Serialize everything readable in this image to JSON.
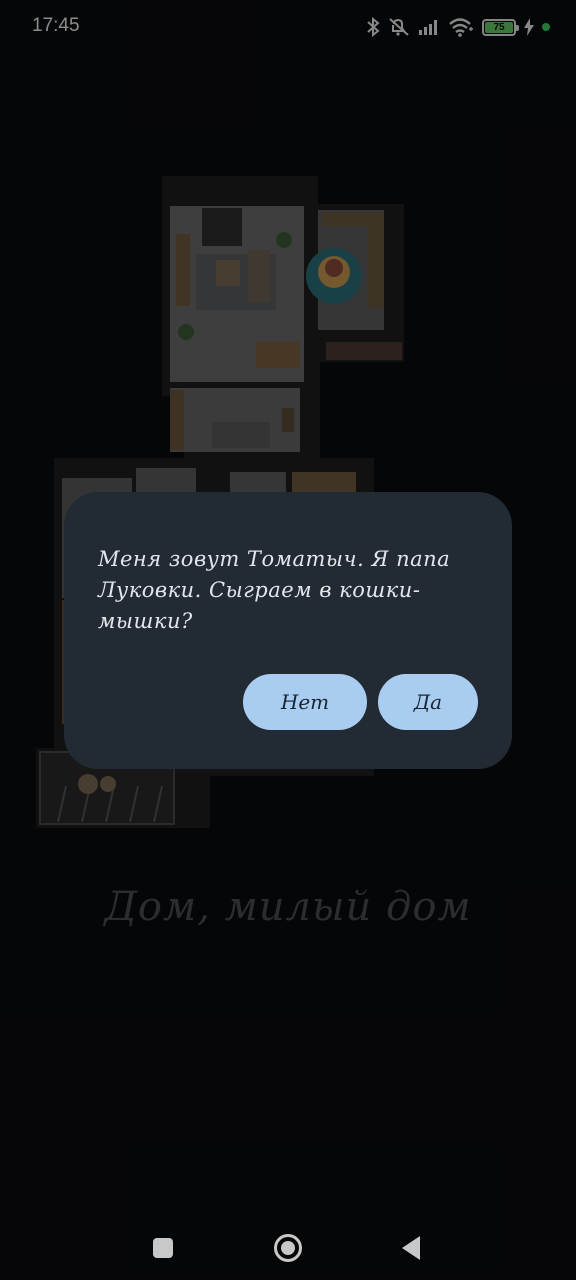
{
  "status_bar": {
    "time": "17:45",
    "battery_level": "75",
    "icons": [
      "bluetooth-icon",
      "mute-icon",
      "signal-icon",
      "wifi-icon",
      "battery-icon",
      "charging-icon",
      "dot-icon"
    ]
  },
  "dialog": {
    "message": "Меня зовут Томатыч. Я папа Луковки. Сыграем в кошки-мышки?",
    "no_label": "Нет",
    "yes_label": "Да"
  },
  "home": {
    "title": "Дом, милый дом"
  },
  "colors": {
    "background": "#0a0b0d",
    "dialog_bg": "#222a33",
    "button_bg": "#a9cdf0",
    "title_color": "#2b2d31"
  },
  "nav_bar": {
    "icons": [
      "recents-icon",
      "home-icon",
      "back-icon"
    ]
  }
}
